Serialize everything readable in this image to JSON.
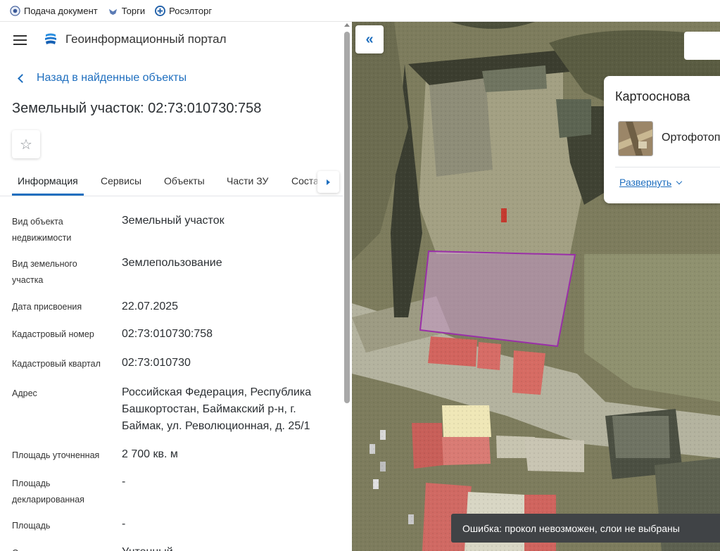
{
  "bookmarks": [
    {
      "label": "Подача документ",
      "icon": "emblem-icon"
    },
    {
      "label": "Торги",
      "icon": "eagle-icon"
    },
    {
      "label": "Росэлторг",
      "icon": "roseltorg-icon"
    }
  ],
  "header": {
    "title": "Геоинформационный портал"
  },
  "nav": {
    "back_label": "Назад в найденные объекты"
  },
  "object": {
    "title": "Земельный участок: 02:73:010730:758"
  },
  "tabs": [
    {
      "label": "Информация",
      "active": true
    },
    {
      "label": "Сервисы",
      "active": false
    },
    {
      "label": "Объекты",
      "active": false
    },
    {
      "label": "Части ЗУ",
      "active": false
    },
    {
      "label": "Состав",
      "active": false
    }
  ],
  "properties": [
    {
      "key": "Вид объекта недвижимости",
      "value": "Земельный участок"
    },
    {
      "key": "Вид земельного участка",
      "value": "Землепользование"
    },
    {
      "key": "Дата присвоения",
      "value": "22.07.2025"
    },
    {
      "key": "Кадастровый номер",
      "value": "02:73:010730:758"
    },
    {
      "key": "Кадастровый квартал",
      "value": "02:73:010730"
    },
    {
      "key": "Адрес",
      "value": "Российская Федерация, Республика Башкортостан, Баймакский р-н, г. Баймак, ул. Революционная, д. 25/1"
    },
    {
      "key": "Площадь уточненная",
      "value": "2 700 кв. м"
    },
    {
      "key": "Площадь декларированная",
      "value": "-"
    },
    {
      "key": "Площадь",
      "value": "-"
    },
    {
      "key": "Статус",
      "value": "Учтенный"
    }
  ],
  "basemap": {
    "title": "Картооснова",
    "selected_label": "Ортофотоп",
    "expand_label": "Развернуть"
  },
  "toast": {
    "message": "Ошибка: прокол невозможен, слои не выбраны"
  },
  "colors": {
    "accent": "#1f6fbf",
    "parcel_outline": "#9a2fa8",
    "toast_bg": "#404346"
  }
}
